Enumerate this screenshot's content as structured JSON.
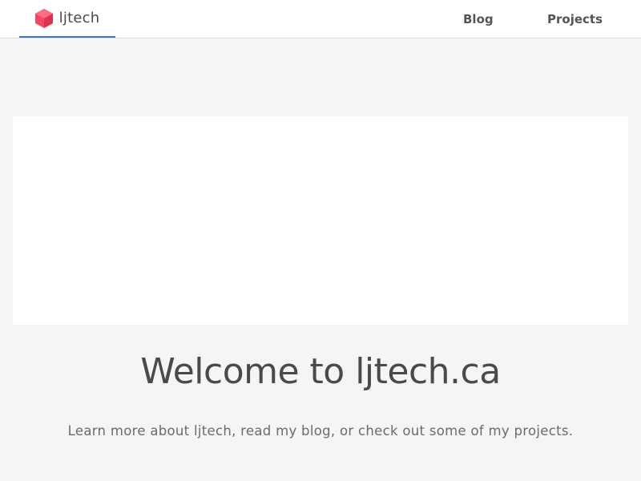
{
  "nav": {
    "brand": {
      "label": "ljtech",
      "icon": "hexagon-logo-icon",
      "icon_color": "#f14668"
    },
    "links": [
      {
        "label": "Blog"
      },
      {
        "label": "Projects"
      }
    ],
    "active_indicator_color": "#3273dc"
  },
  "hero": {
    "title": "Welcome to ljtech.ca",
    "subtitle": "Learn more about ljtech, read my blog, or check out some of my projects."
  },
  "colors": {
    "background": "#f5f5f5",
    "navbar_background": "#ffffff",
    "text": "#4a4a4a"
  }
}
